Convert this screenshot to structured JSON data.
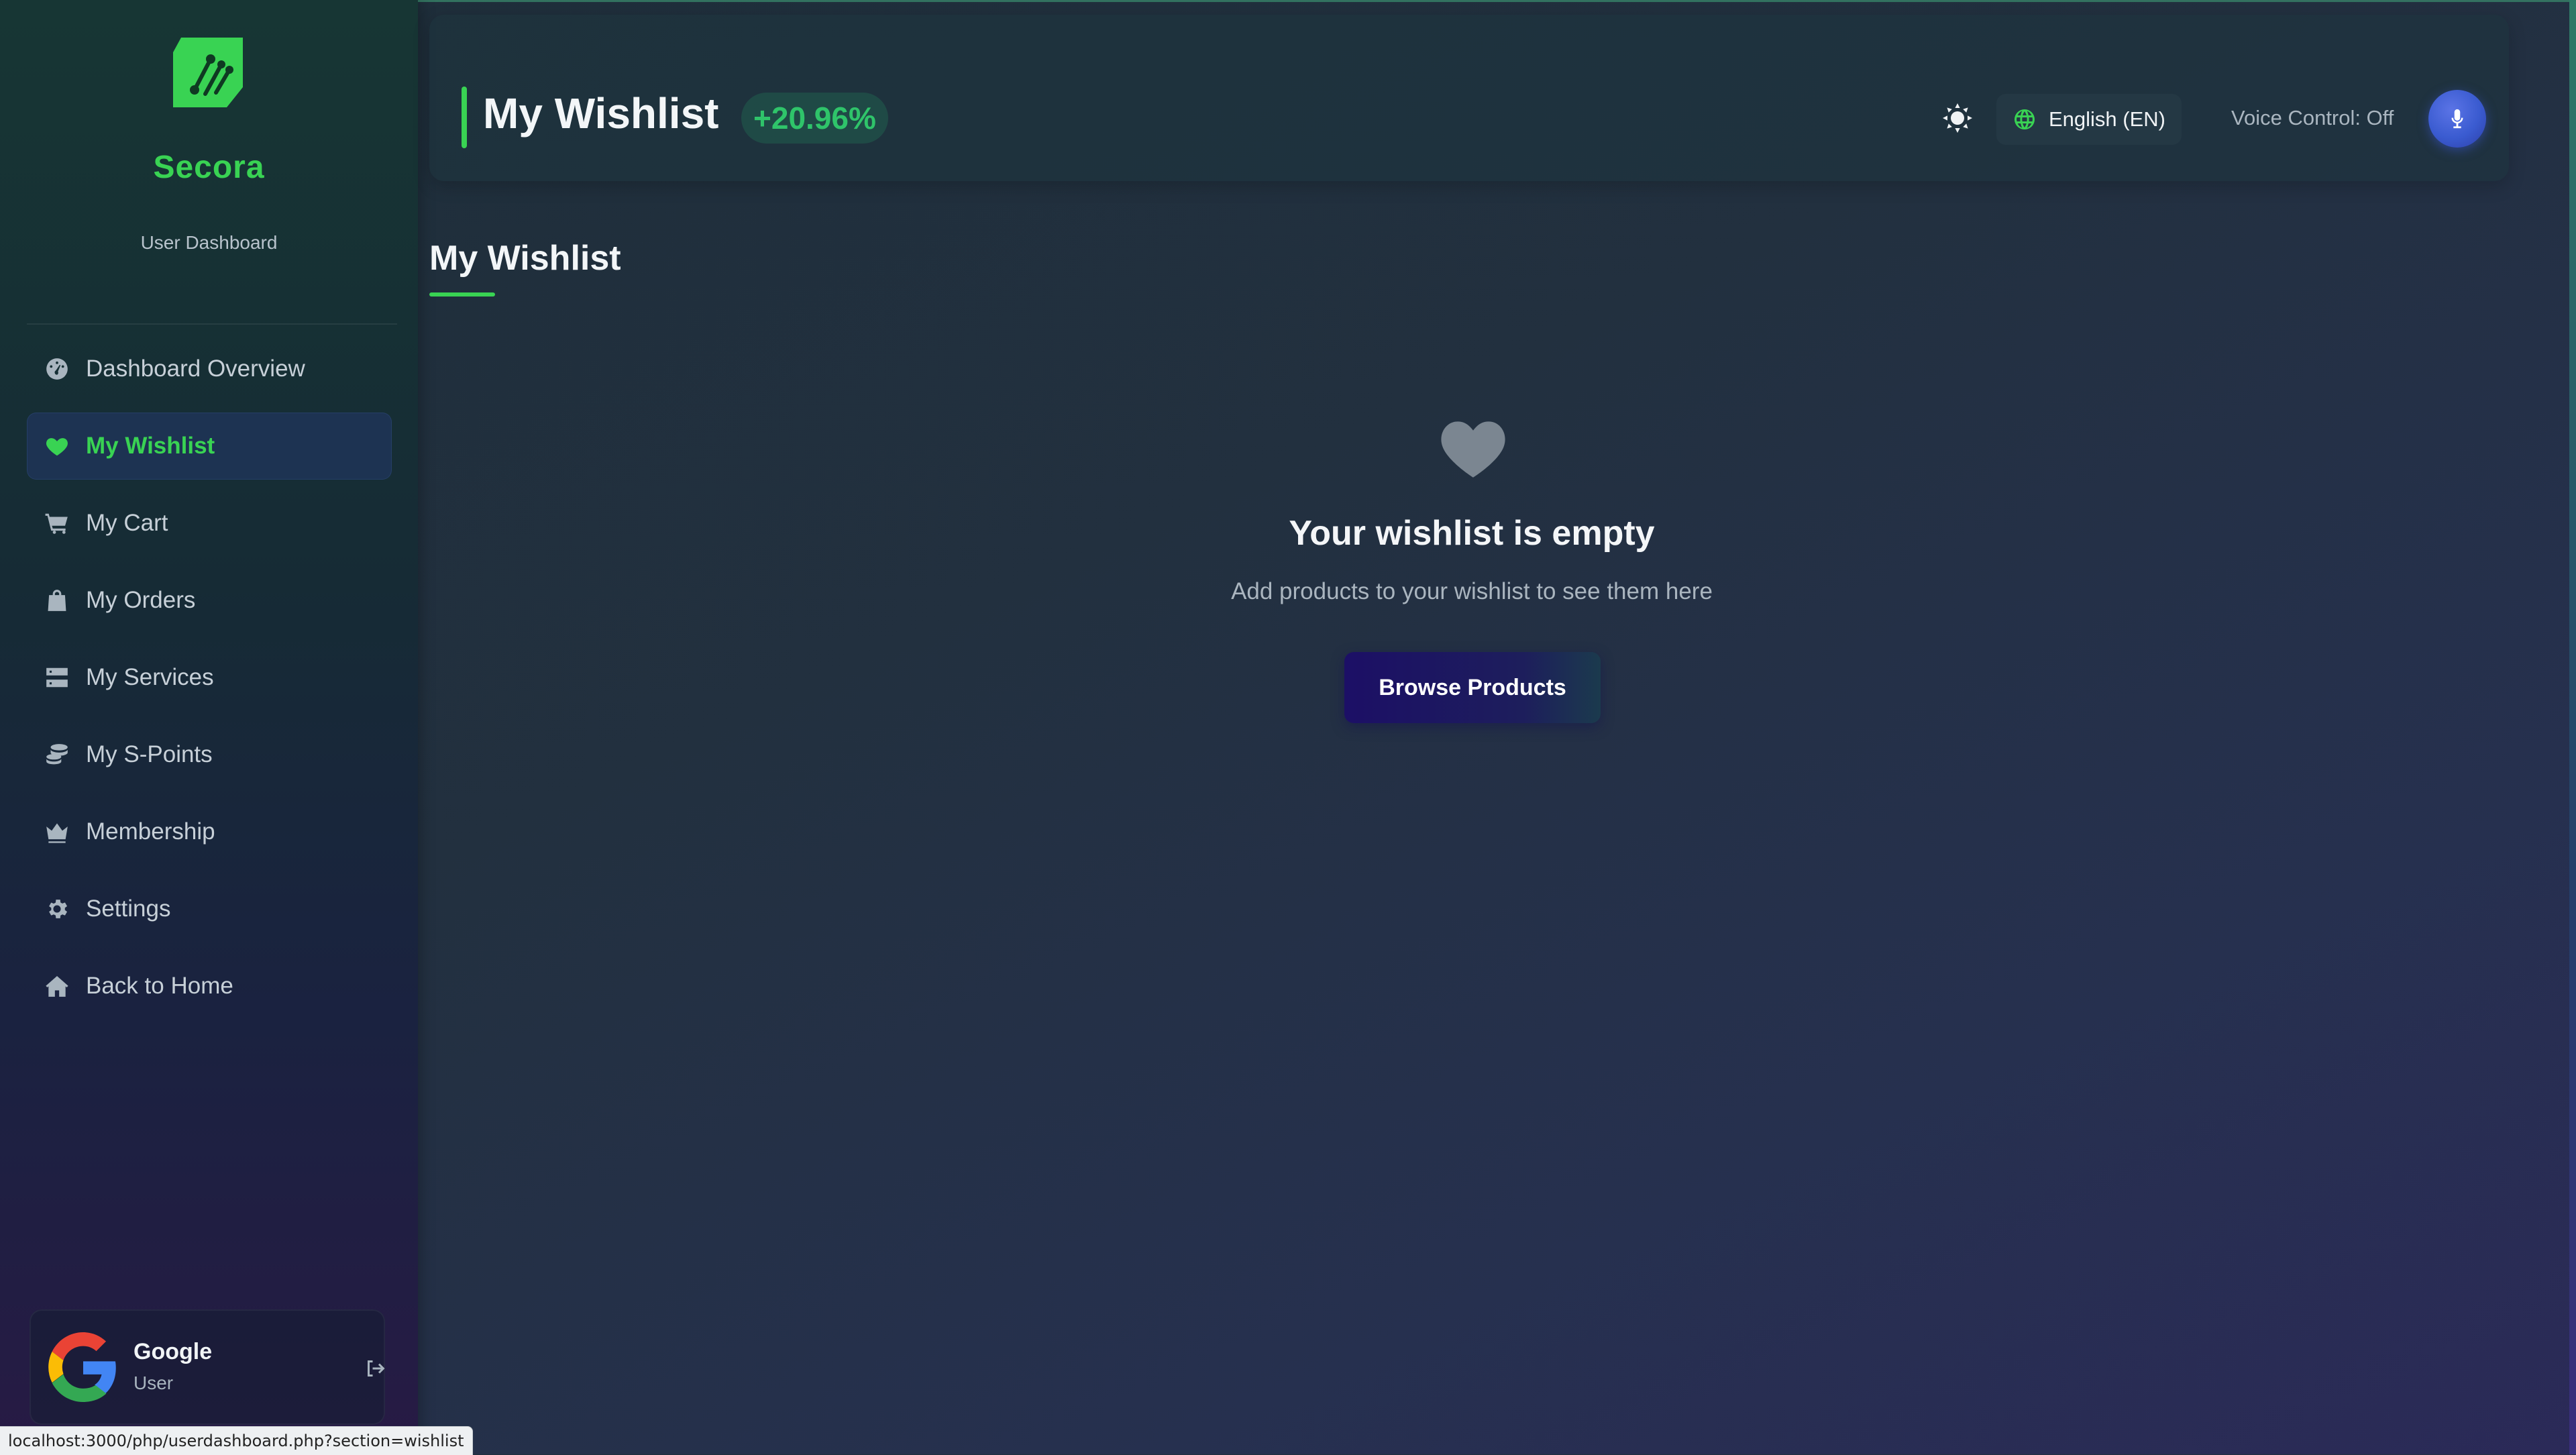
{
  "sidebar": {
    "brand": "Secora",
    "subtitle": "User Dashboard",
    "items": [
      {
        "label": "Dashboard Overview",
        "icon": "dashboard-icon"
      },
      {
        "label": "My Wishlist",
        "icon": "heart-icon",
        "active": true
      },
      {
        "label": "My Cart",
        "icon": "cart-icon"
      },
      {
        "label": "My Orders",
        "icon": "bag-icon"
      },
      {
        "label": "My Services",
        "icon": "server-icon"
      },
      {
        "label": "My S-Points",
        "icon": "coins-icon"
      },
      {
        "label": "Membership",
        "icon": "crown-icon"
      },
      {
        "label": "Settings",
        "icon": "gear-icon"
      },
      {
        "label": "Back to Home",
        "icon": "home-icon"
      }
    ],
    "user": {
      "name": "Google",
      "role": "User"
    }
  },
  "header": {
    "title": "My Wishlist",
    "badge": "+20.96%",
    "language": "English (EN)",
    "voice_control": "Voice Control: Off"
  },
  "main": {
    "section_title": "My Wishlist",
    "empty_title": "Your wishlist is empty",
    "empty_subtitle": "Add products to your wishlist to see them here",
    "browse_button": "Browse Products"
  },
  "status_bar": {
    "url": "localhost:3000/php/userdashboard.php?section=wishlist"
  },
  "colors": {
    "accent": "#39d353",
    "active_bg": "#1d3352",
    "mic": "#3a5bd0"
  }
}
